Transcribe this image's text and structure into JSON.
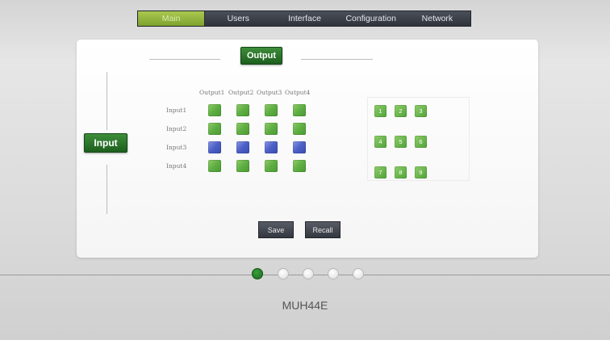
{
  "nav": {
    "tabs": [
      {
        "label": "Main",
        "active": true
      },
      {
        "label": "Users",
        "active": false
      },
      {
        "label": "Interface",
        "active": false
      },
      {
        "label": "Configuration",
        "active": false
      },
      {
        "label": "Network",
        "active": false
      }
    ]
  },
  "matrix": {
    "output_label": "Output",
    "input_label": "Input",
    "columns": [
      "Output1",
      "Output2",
      "Output3",
      "Output4"
    ],
    "rows": [
      "Input1",
      "Input2",
      "Input3",
      "Input4"
    ],
    "selected_row": "Input3",
    "selected_color": "#4b5fc6",
    "unselected_color": "#5fae43"
  },
  "presets": [
    "1",
    "2",
    "3",
    "4",
    "5",
    "6",
    "7",
    "8",
    "9"
  ],
  "buttons": {
    "save": "Save",
    "recall": "Recall"
  },
  "pager": {
    "count": 5,
    "active": 1
  },
  "model": "MUH44E"
}
